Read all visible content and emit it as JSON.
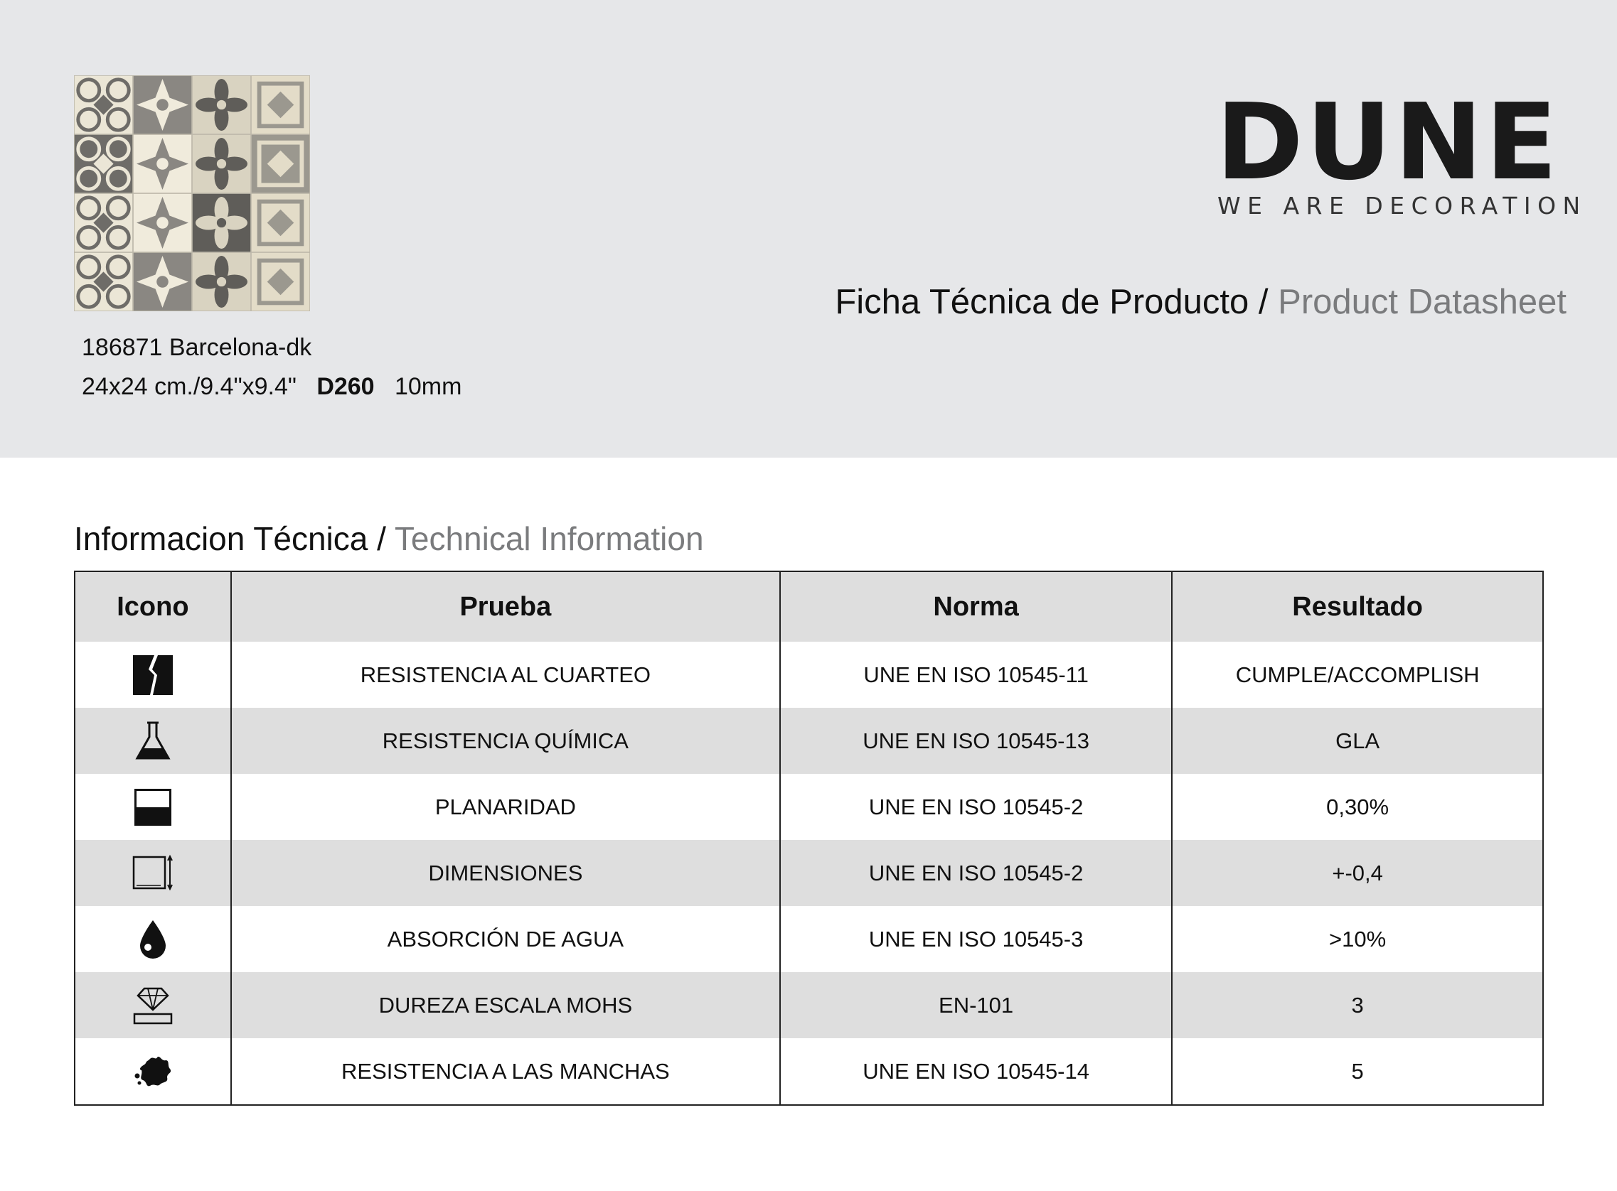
{
  "product": {
    "code_name": "186871 Barcelona-dk",
    "size": "24x24 cm./9.4\"x9.4\"",
    "model": "D260",
    "thickness": "10mm",
    "image_icon": "patterned-tile-mosaic"
  },
  "brand": {
    "logo_text": "DUNE",
    "tagline": "WE ARE DECORATION"
  },
  "header": {
    "title_es": "Ficha Técnica de Producto",
    "separator": " / ",
    "title_en": "Product Datasheet"
  },
  "section": {
    "title_es": "Informacion Técnica",
    "separator": " / ",
    "title_en": "Technical Information"
  },
  "table": {
    "columns": [
      "Icono",
      "Prueba",
      "Norma",
      "Resultado"
    ],
    "rows": [
      {
        "icon": "crack-icon",
        "test": "RESISTENCIA AL CUARTEO",
        "norm": "UNE EN ISO 10545-11",
        "result": "CUMPLE/ACCOMPLISH"
      },
      {
        "icon": "flask-icon",
        "test": "RESISTENCIA QUÍMICA",
        "norm": "UNE EN ISO 10545-13",
        "result": "GLA"
      },
      {
        "icon": "flatness-icon",
        "test": "PLANARIDAD",
        "norm": "UNE EN ISO 10545-2",
        "result": "0,30%"
      },
      {
        "icon": "dimensions-icon",
        "test": "DIMENSIONES",
        "norm": "UNE EN ISO 10545-2",
        "result": "+-0,4"
      },
      {
        "icon": "water-drop-icon",
        "test": "ABSORCIÓN DE AGUA",
        "norm": "UNE EN ISO 10545-3",
        "result": ">10%"
      },
      {
        "icon": "diamond-hardness-icon",
        "test": "DUREZA ESCALA MOHS",
        "norm": "EN-101",
        "result": "3"
      },
      {
        "icon": "stain-icon",
        "test": "RESISTENCIA A LAS MANCHAS",
        "norm": "UNE EN ISO 10545-14",
        "result": "5"
      }
    ]
  },
  "colors": {
    "header_bg": "#e6e7e9",
    "row_alt_bg": "#dedede",
    "secondary_text": "#7a7b7d"
  }
}
